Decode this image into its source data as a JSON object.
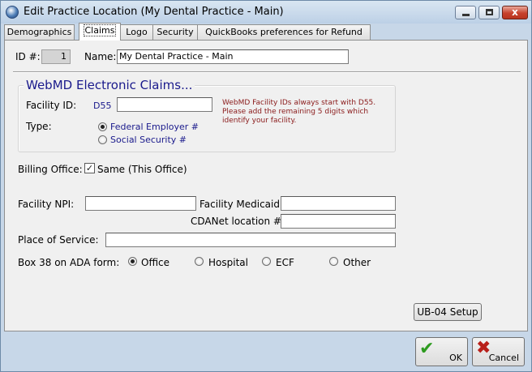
{
  "window": {
    "title": "Edit Practice Location (My Dental Practice - Main)",
    "close_glyph": "x"
  },
  "tabs": [
    {
      "label": "Demographics"
    },
    {
      "label": "Claims"
    },
    {
      "label": "Logo"
    },
    {
      "label": "Security"
    },
    {
      "label": "QuickBooks preferences for Refund"
    }
  ],
  "header": {
    "id_label": "ID #:",
    "id_value": "1",
    "name_label": "Name:",
    "name_value": "My Dental Practice - Main"
  },
  "webmd": {
    "title": "WebMD Electronic Claims...",
    "facility_id_label": "Facility ID:",
    "facility_prefix": "D55",
    "facility_id_value": "",
    "note": "WebMD Facility IDs always start with D55. Please add the remaining 5 digits which identify your facility.",
    "type_label": "Type:",
    "type_options": [
      {
        "label": "Federal Employer #",
        "selected": true
      },
      {
        "label": "Social Security #",
        "selected": false
      }
    ]
  },
  "billing": {
    "label": "Billing Office:",
    "checkbox_label": "Same (This Office)",
    "checked": true,
    "check_glyph": "✓"
  },
  "fields": {
    "npi_label": "Facility NPI:",
    "npi_value": "",
    "medicaid_label": "Facility Medicaid:",
    "medicaid_value": "",
    "cdanet_label": "CDANet location #:",
    "cdanet_value": "",
    "pos_label": "Place of Service:",
    "pos_value": ""
  },
  "box38": {
    "label": "Box 38 on ADA form:",
    "options": [
      {
        "label": "Office",
        "selected": true
      },
      {
        "label": "Hospital",
        "selected": false
      },
      {
        "label": "ECF",
        "selected": false
      },
      {
        "label": "Other",
        "selected": false
      }
    ]
  },
  "buttons": {
    "ub04": "UB-04 Setup",
    "ok": "OK",
    "ok_icon": "✔",
    "cancel": "Cancel",
    "cancel_icon": "✖"
  }
}
